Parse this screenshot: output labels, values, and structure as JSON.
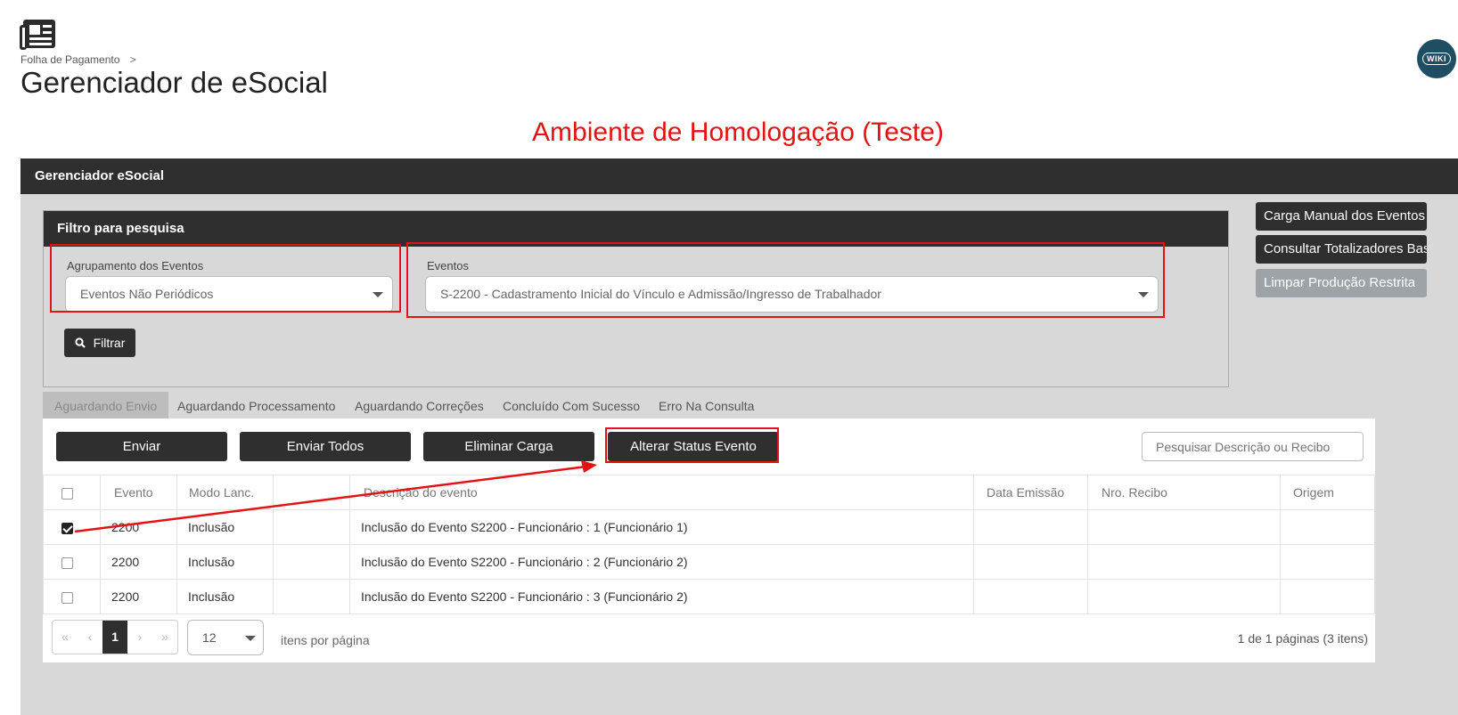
{
  "header": {
    "breadcrumb": "Folha de Pagamento",
    "breadcrumb_sep": ">",
    "title": "Gerenciador de eSocial",
    "wiki_label": "WIKI"
  },
  "environment_banner": "Ambiente de Homologação (Teste)",
  "panel": {
    "title": "Gerenciador eSocial"
  },
  "filter": {
    "title": "Filtro para pesquisa",
    "grouping_label": "Agrupamento dos Eventos",
    "grouping_value": "Eventos Não Periódicos",
    "events_label": "Eventos",
    "events_value": "S-2200 - Cadastramento Inicial do Vínculo e Admissão/Ingresso de Trabalhador",
    "filter_button": "Filtrar"
  },
  "side_actions": {
    "carga_manual": "Carga Manual dos Eventos",
    "consultar_totalizadores": "Consultar Totalizadores Base",
    "limpar_producao": "Limpar Produção Restrita"
  },
  "tabs": [
    {
      "label": "Aguardando Envio",
      "active": true
    },
    {
      "label": "Aguardando Processamento",
      "active": false
    },
    {
      "label": "Aguardando Correções",
      "active": false
    },
    {
      "label": "Concluído Com Sucesso",
      "active": false
    },
    {
      "label": "Erro Na Consulta",
      "active": false
    }
  ],
  "actions": {
    "enviar": "Enviar",
    "enviar_todos": "Enviar Todos",
    "eliminar_carga": "Eliminar Carga",
    "alterar_status": "Alterar Status Evento",
    "search_placeholder": "Pesquisar Descrição ou Recibo"
  },
  "table": {
    "columns": [
      "Evento",
      "Modo Lanc.",
      "",
      "Descrição do evento",
      "Data Emissão",
      "Nro. Recibo",
      "Origem"
    ],
    "rows": [
      {
        "checked": true,
        "evento": "2200",
        "modo": "Inclusão",
        "extra": "",
        "descricao": "Inclusão do Evento S2200 - Funcionário : 1 (Funcionário 1)",
        "data": "",
        "recibo": "",
        "origem": ""
      },
      {
        "checked": false,
        "evento": "2200",
        "modo": "Inclusão",
        "extra": "",
        "descricao": "Inclusão do Evento S2200 - Funcionário : 2 (Funcionário 2)",
        "data": "",
        "recibo": "",
        "origem": ""
      },
      {
        "checked": false,
        "evento": "2200",
        "modo": "Inclusão",
        "extra": "",
        "descricao": "Inclusão do Evento S2200 - Funcionário : 3 (Funcionário 2)",
        "data": "",
        "recibo": "",
        "origem": ""
      }
    ]
  },
  "pagination": {
    "first": "«",
    "prev": "‹",
    "current": "1",
    "next": "›",
    "last": "»",
    "page_size": "12",
    "per_page_label": "itens por página",
    "info": "1 de 1 páginas (3 itens)"
  },
  "colors": {
    "dark": "#2f2f2f",
    "panel_bg": "#d8d8d8",
    "highlight": "#e31313",
    "disabled_button": "#9ea3a7",
    "wiki_badge": "#1f4e63"
  },
  "icons": {
    "app": "newspaper-icon",
    "filter": "search-icon",
    "wiki": "wiki-icon",
    "checkbox": "checkbox-icon"
  }
}
